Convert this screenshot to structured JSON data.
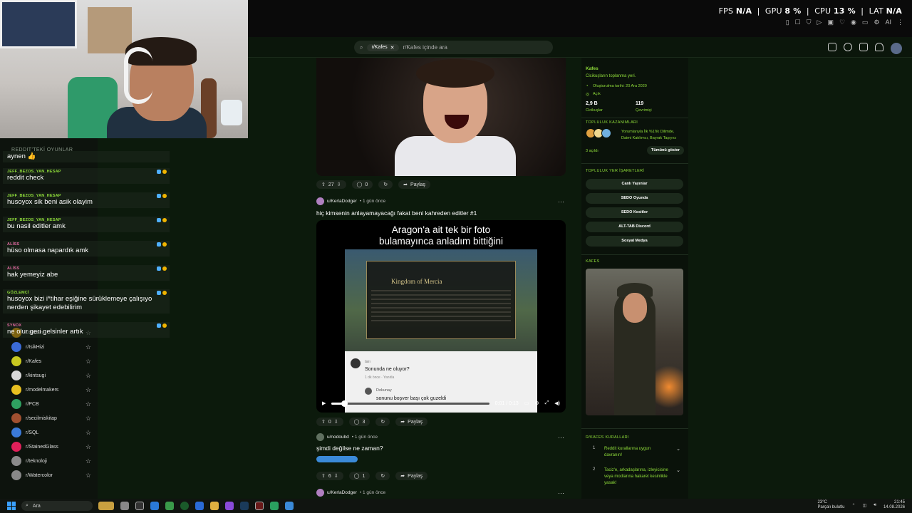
{
  "hud": {
    "fps_label": "FPS",
    "fps": "N/A",
    "gpu_label": "GPU",
    "gpu": "8 %",
    "cpu_label": "CPU",
    "cpu": "13 %",
    "lat_label": "LAT",
    "lat": "N/A",
    "ai": "AI"
  },
  "search": {
    "community": "r/Kafes",
    "placeholder": "r/Kafes içinde ara"
  },
  "sidebar": {
    "section_title": "REDDIT'TEKİ OYUNLAR",
    "items": [
      {
        "label": "r/bitcoin",
        "color": "#f2a900"
      },
      {
        "label": "r/IsikHizi",
        "color": "#3b6bd8"
      },
      {
        "label": "r/Kafes",
        "color": "#c8c820"
      },
      {
        "label": "r/kintsugi",
        "color": "#d8d8d8"
      },
      {
        "label": "r/modelmakers",
        "color": "#e8c020"
      },
      {
        "label": "r/PCB",
        "color": "#2fa060"
      },
      {
        "label": "r/secilmiskitap",
        "color": "#a05030"
      },
      {
        "label": "r/SQL",
        "color": "#3b7ad8"
      },
      {
        "label": "r/StainedGlass",
        "color": "#e0205a"
      },
      {
        "label": "r/teknoloji",
        "color": "#8a8a8a"
      },
      {
        "label": "r/Watercolor",
        "color": "#888888"
      }
    ]
  },
  "chat": {
    "messages": [
      {
        "user": "",
        "text": "aynen 👍"
      },
      {
        "user": "JEFF_BEZOS_YAN_HESAP",
        "text": "reddit check"
      },
      {
        "user": "JEFF_BEZOS_YAN_HESAP",
        "text": "husoyox sik beni asik olayim"
      },
      {
        "user": "JEFF_BEZOS_YAN_HESAP",
        "text": "bu nasil editler amk"
      },
      {
        "user": "ALİSS",
        "text": "hüso olmasa napardık amk"
      },
      {
        "user": "ALİSS",
        "text": "hak yemeyiz abe"
      },
      {
        "user": "GÖZLEMCİ",
        "text": "husoyox bizi i*tihar eşiğine sürüklemeye çalışıyo nerden şikayet edebilirim"
      },
      {
        "user": "SYNOX",
        "text": "ne olur geri gelsinler artık"
      }
    ]
  },
  "feed": {
    "post1": {
      "upvotes": "27",
      "comments": "0",
      "share": "Paylaş"
    },
    "post2": {
      "user": "u/KerlaDodger",
      "time": "• 1 gün önce",
      "more": "···",
      "title": "hiç kimsenin anlayamayacağı fakat beni kahreden editler #1",
      "caption_line1": "Aragon'a ait tek bir foto",
      "caption_line2": "bulamayınca anladım bittiğini",
      "kingdom": "Kingdom of Mercia",
      "comment_name": "tarı",
      "comment_text": "Sonunda ne oluyor?",
      "comment_meta": "1 dk önce · Yanıtla",
      "reply_name": "Dokunay",
      "reply_text": "sonunu boşver başı çok guzeldi",
      "time_display": "0:01 / 0:13",
      "progress": 0.08,
      "upvotes": "0",
      "comments": "3",
      "share": "Paylaş"
    },
    "post3": {
      "user": "u/nodoubd",
      "time": "• 1 gün önce",
      "more": "···",
      "title": "şimdi değilse ne zaman?",
      "upvotes": "6",
      "comments": "1",
      "share": "Paylaş"
    },
    "post4": {
      "user": "u/KerlaDodger",
      "time": "• 1 gün önce",
      "more": "···"
    }
  },
  "community": {
    "name": "Kafes",
    "tagline": "Cicikuşların toplanma yeri.",
    "created": "Oluşturulma tarihi: 20 Ara 2020",
    "visibility": "Açık",
    "members": "2,9 B",
    "members_label": "Cicikuşlar",
    "online": "119",
    "online_label": "Çevrimiçi",
    "achievements_title": "TOPLULUK KAZANIMLARI",
    "achievements_text": "Yorumlarıyla İlk %1'lik Dilimde, Daimi Katılımcı, Bayrak Taşıyıcı",
    "achievements_count": "3 açıldı",
    "show_all": "Tümünü göster",
    "bookmarks_title": "TOPLULUK YER İŞARETLERİ",
    "bookmarks": [
      "Canlı Yayınlar",
      "SEDO Oyunda",
      "SEDO Kesitler",
      "ALT-TAB Discord",
      "Sosyal Medya"
    ],
    "image_title": "KAFES",
    "rules_title": "R/KAFES KURALLARI",
    "rules": [
      {
        "n": "1",
        "text": "Reddit kurallarına uygun davranın!"
      },
      {
        "n": "2",
        "text": "Taciz'e, arkadaşlarına, izleyicisine veya modlarına hakaret kesinlikle yasak!"
      }
    ]
  },
  "taskbar": {
    "search_placeholder": "Ara",
    "temp": "23°C",
    "weather": "Parçalı bulutlu",
    "time": "21:45",
    "date": "14.08.2026"
  }
}
